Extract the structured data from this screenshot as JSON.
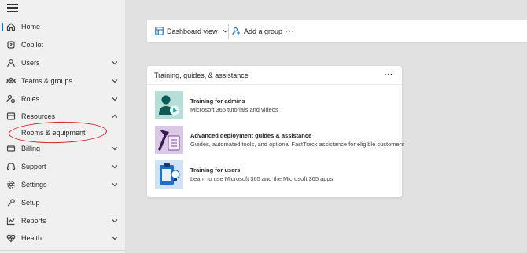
{
  "sidebar": {
    "items": [
      {
        "label": "Home",
        "icon": "home-icon",
        "has_chevron": false,
        "active": true
      },
      {
        "label": "Copilot",
        "icon": "copilot-icon",
        "has_chevron": false
      },
      {
        "label": "Users",
        "icon": "person-icon",
        "has_chevron": true,
        "chevron": "down"
      },
      {
        "label": "Teams & groups",
        "icon": "people-team-icon",
        "has_chevron": true,
        "chevron": "down"
      },
      {
        "label": "Roles",
        "icon": "roles-icon",
        "has_chevron": true,
        "chevron": "down"
      },
      {
        "label": "Resources",
        "icon": "resources-icon",
        "has_chevron": true,
        "chevron": "up"
      },
      {
        "label": "Billing",
        "icon": "billing-icon",
        "has_chevron": true,
        "chevron": "down"
      },
      {
        "label": "Support",
        "icon": "headset-icon",
        "has_chevron": true,
        "chevron": "down"
      },
      {
        "label": "Settings",
        "icon": "gear-icon",
        "has_chevron": true,
        "chevron": "down"
      },
      {
        "label": "Setup",
        "icon": "wrench-icon",
        "has_chevron": false
      },
      {
        "label": "Reports",
        "icon": "chart-icon",
        "has_chevron": true,
        "chevron": "down"
      },
      {
        "label": "Health",
        "icon": "heart-pulse-icon",
        "has_chevron": true,
        "chevron": "down"
      }
    ],
    "sub_items": [
      {
        "label": "Rooms & equipment",
        "parent": "Resources"
      }
    ],
    "annotation_color": "#d0222a"
  },
  "toolbar": {
    "dashboard_view_label": "Dashboard view",
    "add_group_label": "Add a group",
    "more_label": "···"
  },
  "card": {
    "title": "Training, guides, & assistance",
    "more_label": "···",
    "items": [
      {
        "title": "Training for admins",
        "description": "Microsoft 365 tutorials and videos",
        "icon": "admin-training-icon",
        "tile_color": "#b6dfd8"
      },
      {
        "title": "Advanced deployment guides & assistance",
        "description": "Guides, automated tools, and optional FastTrack assistance for eligible customers",
        "icon": "hammer-checklist-icon",
        "tile_color": "#d9c8e6"
      },
      {
        "title": "Training for users",
        "description": "Learn to use Microsoft 365 and the Microsoft 365 apps",
        "icon": "clipboard-lightbulb-icon",
        "tile_color": "#cfe3f5"
      }
    ]
  },
  "colors": {
    "accent": "#0f6cbd",
    "sidebar_bg": "#f0f0f0",
    "content_bg": "#e1e1e1"
  }
}
